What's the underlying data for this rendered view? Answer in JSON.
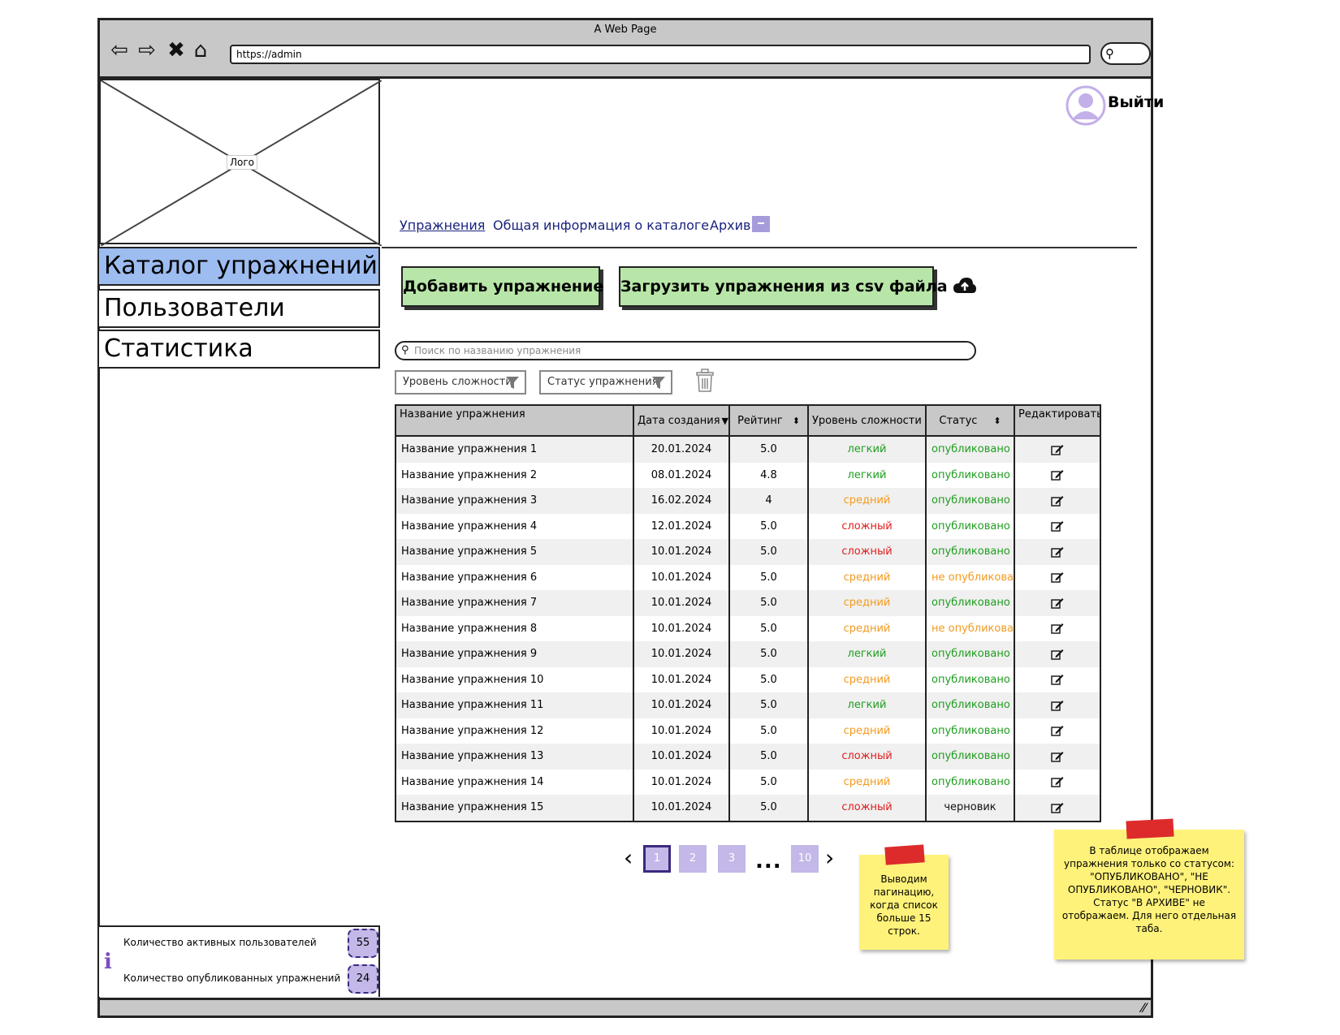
{
  "browser": {
    "title": "A Web Page",
    "url": "https://admin",
    "nav_icons": [
      "back-arrow-icon",
      "forward-arrow-icon",
      "close-x-icon",
      "home-icon"
    ],
    "search_icon": "magnifier-icon"
  },
  "logo": {
    "label": "Лого"
  },
  "sidebar": {
    "items": [
      {
        "label": "Каталог упражнений",
        "active": true
      },
      {
        "label": "Пользователи",
        "active": false
      },
      {
        "label": "Статистика",
        "active": false
      }
    ]
  },
  "header": {
    "logout_label": "Выйти",
    "avatar_icon": "user-avatar-icon"
  },
  "tabs": [
    {
      "label": "Упражнения",
      "active": true
    },
    {
      "label": "Общая информация о каталоге",
      "active": false
    },
    {
      "label": "Архив",
      "active": false,
      "icon": "archive-icon"
    }
  ],
  "actions": {
    "add_label": "Добавить упражнение",
    "csv_label": "Загрузить упражнения из csv файла",
    "csv_icon": "cloud-upload-icon"
  },
  "search": {
    "placeholder": "Поиск по названию упражнения"
  },
  "filters": {
    "level_label": "Уровень сложности",
    "status_label": "Статус упражнения",
    "clear_icon": "trash-icon"
  },
  "table": {
    "headers": {
      "name": "Название упражнения",
      "date": "Дата создания",
      "rating": "Рейтинг",
      "level": "Уровень сложности",
      "status": "Статус",
      "edit": "Редактировать"
    },
    "rows": [
      {
        "name": "Название упражнения 1",
        "date": "20.01.2024",
        "rating": "5.0",
        "level": "легкий",
        "status": "опубликовано"
      },
      {
        "name": "Название упражнения 2",
        "date": "08.01.2024",
        "rating": "4.8",
        "level": "легкий",
        "status": "опубликовано"
      },
      {
        "name": "Название упражнения 3",
        "date": "16.02.2024",
        "rating": "4",
        "level": "средний",
        "status": "опубликовано"
      },
      {
        "name": "Название упражнения 4",
        "date": "12.01.2024",
        "rating": "5.0",
        "level": "сложный",
        "status": "опубликовано"
      },
      {
        "name": "Название упражнения 5",
        "date": "10.01.2024",
        "rating": "5.0",
        "level": "сложный",
        "status": "опубликовано"
      },
      {
        "name": "Название упражнения 6",
        "date": "10.01.2024",
        "rating": "5.0",
        "level": "средний",
        "status": "не опубликовано"
      },
      {
        "name": "Название упражнения 7",
        "date": "10.01.2024",
        "rating": "5.0",
        "level": "средний",
        "status": "опубликовано"
      },
      {
        "name": "Название упражнения 8",
        "date": "10.01.2024",
        "rating": "5.0",
        "level": "средний",
        "status": "не опубликовано"
      },
      {
        "name": "Название упражнения 9",
        "date": "10.01.2024",
        "rating": "5.0",
        "level": "легкий",
        "status": "опубликовано"
      },
      {
        "name": "Название упражнения 10",
        "date": "10.01.2024",
        "rating": "5.0",
        "level": "средний",
        "status": "опубликовано"
      },
      {
        "name": "Название упражнения 11",
        "date": "10.01.2024",
        "rating": "5.0",
        "level": "легкий",
        "status": "опубликовано"
      },
      {
        "name": "Название упражнения 12",
        "date": "10.01.2024",
        "rating": "5.0",
        "level": "средний",
        "status": "опубликовано"
      },
      {
        "name": "Название упражнения 13",
        "date": "10.01.2024",
        "rating": "5.0",
        "level": "сложный",
        "status": "опубликовано"
      },
      {
        "name": "Название упражнения 14",
        "date": "10.01.2024",
        "rating": "5.0",
        "level": "средний",
        "status": "опубликовано"
      },
      {
        "name": "Название упражнения 15",
        "date": "10.01.2024",
        "rating": "5.0",
        "level": "сложный",
        "status": "черновик"
      }
    ]
  },
  "colors": {
    "easy": "#1e9e1e",
    "medium": "#f39a1e",
    "hard": "#e01d1d",
    "published": "#1e9e1e",
    "unpublished": "#f39a1e",
    "draft": "#111111",
    "active_nav": "#9dbcf0",
    "button_green": "#b8e6a8",
    "accent_purple": "#c3b8e8"
  },
  "pagination": {
    "pages": [
      "1",
      "2",
      "3",
      "10"
    ],
    "current": "1",
    "ellipsis": "..."
  },
  "notes": {
    "pagination_note": "Выводим пагинацию, когда список больше 15 строк.",
    "status_note": "В таблице отображаем упражнения только со статусом: \"ОПУБЛИКОВАНО\", \"НЕ ОПУБЛИКОВАНО\", \"ЧЕРНОВИК\". Статус \"В АРХИВЕ\" не отображаем. Для него отдельная таба."
  },
  "stats": {
    "active_users_label": "Количество активных пользователей",
    "active_users_value": "55",
    "published_label": "Количество опубликованных упражнений",
    "published_value": "24",
    "icon": "info-icon"
  }
}
